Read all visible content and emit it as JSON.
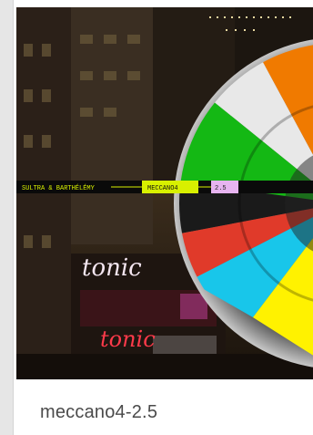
{
  "album": {
    "title": "meccano4-2.5",
    "cover": {
      "band_artists": "SULTRA & BARTHÉLÉMY",
      "band_album": "MECCANO4",
      "band_version": "2.5",
      "sign_text_1": "tonic",
      "sign_text_2": "tonic"
    }
  },
  "colors": {
    "band": "#d8f000",
    "pie_orange": "#f07a00",
    "pie_green": "#14b814",
    "pie_red": "#e03a2a",
    "pie_cyan": "#18c6ea",
    "pie_yellow": "#fff200",
    "pie_white": "#f0f0f0"
  }
}
